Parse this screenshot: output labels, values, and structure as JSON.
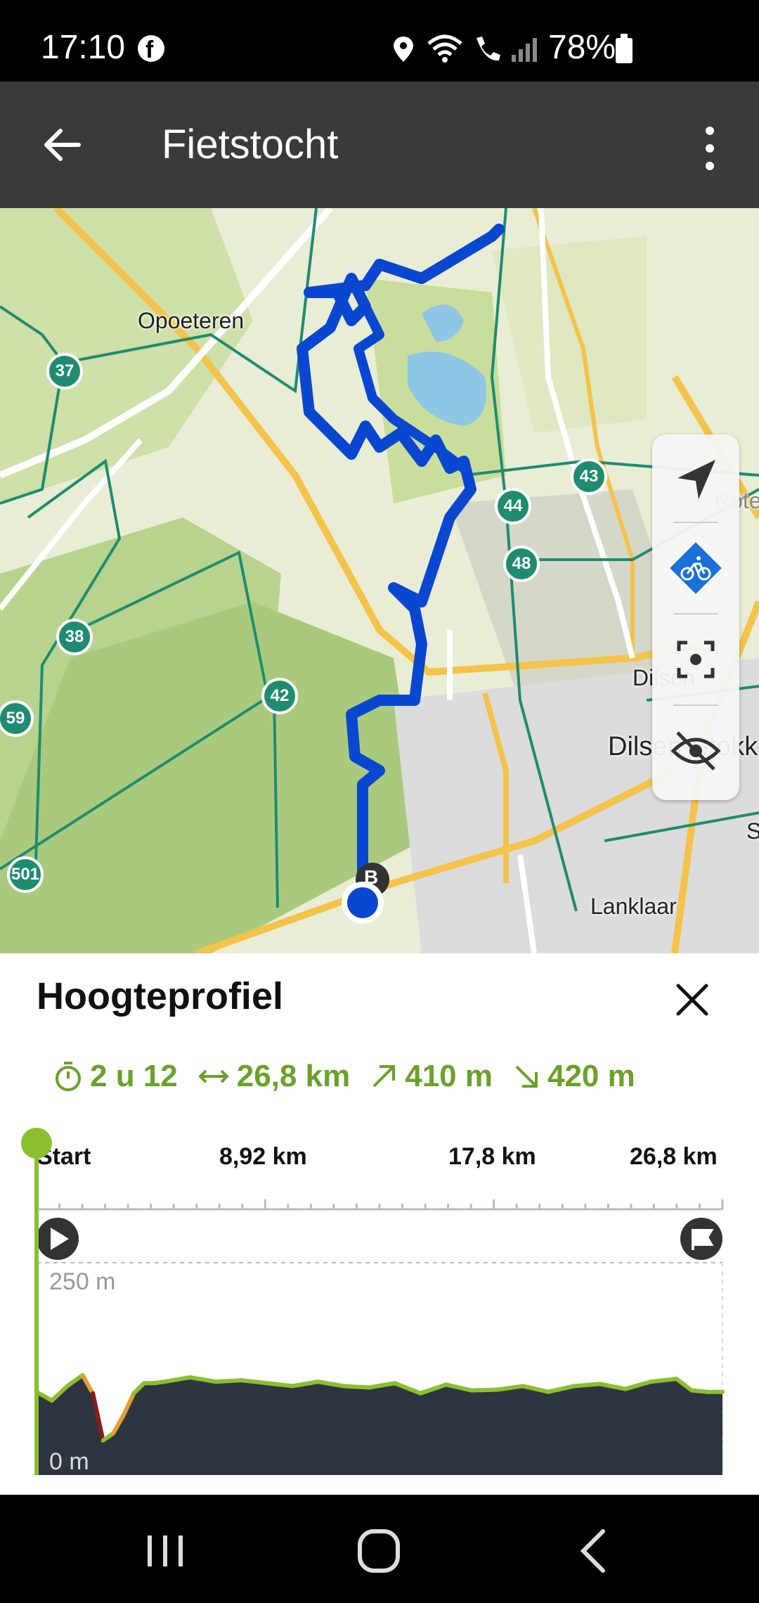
{
  "status_bar": {
    "time": "17:10",
    "battery": "78%",
    "icons": [
      "facebook-icon",
      "location-icon",
      "wifi-icon",
      "wifi-calling-icon",
      "signal-icon",
      "battery-icon"
    ]
  },
  "app_bar": {
    "title": "Fietstocht",
    "icons": [
      "back-arrow-icon",
      "more-vert-icon"
    ]
  },
  "map": {
    "places": [
      "Opoeteren",
      "Dilsen",
      "Dilsen-Stokk",
      "Lanklaar",
      "Rote",
      "S"
    ],
    "nodes": [
      "37",
      "38",
      "59",
      "42",
      "501",
      "43",
      "44",
      "48"
    ],
    "start_marker": "B",
    "controls": [
      "navigate-icon",
      "bike-route-icon",
      "recenter-icon",
      "hide-icon"
    ],
    "colors": {
      "route": "#0a47d1",
      "node": "#1f8c6f",
      "primary_road": "#f4c34a",
      "network": "#1f8c6f"
    }
  },
  "elevation_sheet": {
    "title": "Hoogteprofiel",
    "stats": {
      "duration": "2 u 12",
      "distance": "26,8 km",
      "ascent": "410 m",
      "descent": "420 m"
    },
    "axis": {
      "km_labels": [
        "Start",
        "8,92 km",
        "17,8 km",
        "26,8 km"
      ],
      "elev_labels": [
        "250 m",
        "0 m"
      ]
    },
    "colors": {
      "stat_green": "#6aa12a",
      "profile_fill": "#2e3541",
      "profile_line": "#8bbf2f"
    }
  },
  "chart_data": {
    "type": "area",
    "title": "Hoogteprofiel",
    "x_unit": "km",
    "y_unit": "m",
    "xlim": [
      0,
      26.8
    ],
    "ylim": [
      0,
      250
    ],
    "x": [
      0,
      0.6,
      1.2,
      1.8,
      2.2,
      2.6,
      3.0,
      3.4,
      3.8,
      4.2,
      4.6,
      5.0,
      6.0,
      7.0,
      8.0,
      9.0,
      10.0,
      11.0,
      12.0,
      13.0,
      14.0,
      15.0,
      16.0,
      17.0,
      18.0,
      19.0,
      20.0,
      21.0,
      22.0,
      23.0,
      24.0,
      25.0,
      25.6,
      26.2,
      26.8
    ],
    "y": [
      72,
      60,
      80,
      95,
      70,
      5,
      15,
      40,
      70,
      84,
      84,
      86,
      92,
      86,
      88,
      84,
      80,
      86,
      80,
      78,
      84,
      70,
      82,
      74,
      75,
      80,
      72,
      80,
      83,
      76,
      86,
      90,
      74,
      72,
      72
    ]
  }
}
